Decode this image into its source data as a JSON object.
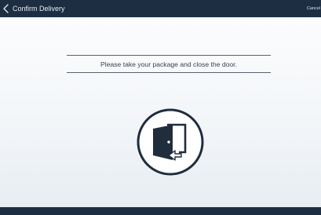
{
  "header": {
    "title": "Confirm Delivery",
    "cancel_label": "Cancel",
    "back_icon": "chevron-left-icon"
  },
  "main": {
    "message": "Please take your package and close the door.",
    "door_icon": "door-close-icon"
  },
  "colors": {
    "bar": "#1d2e43",
    "icon_ring": "#1f2d3d",
    "line": "#59626d"
  }
}
